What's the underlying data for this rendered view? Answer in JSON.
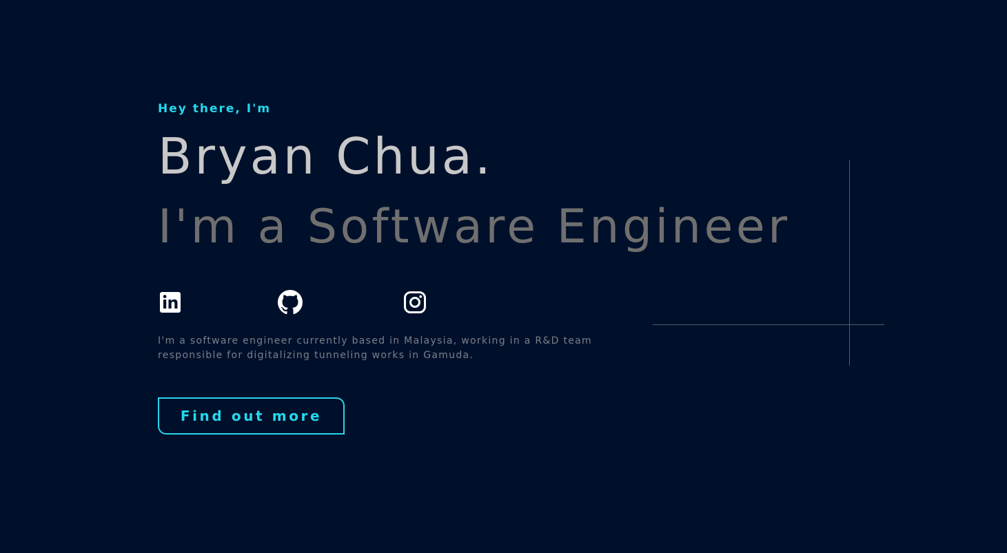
{
  "hero": {
    "greeting": "Hey there, I'm",
    "name": "Bryan Chua.",
    "role": "I'm a Software Engineer",
    "bio": "I'm a software engineer currently based in Malaysia, working in a R&D team responsible for digitalizing tunneling works in Gamuda.",
    "cta_label": "Find out more"
  },
  "socials": [
    {
      "icon": "linkedin-icon"
    },
    {
      "icon": "github-icon"
    },
    {
      "icon": "instagram-icon"
    }
  ],
  "colors": {
    "background": "#00102b",
    "accent": "#26d7eb",
    "name_text": "#c8c8c8",
    "role_text": "#6f6f6f",
    "bio_text": "#7b7f8a",
    "decor_line": "#565d6b"
  }
}
